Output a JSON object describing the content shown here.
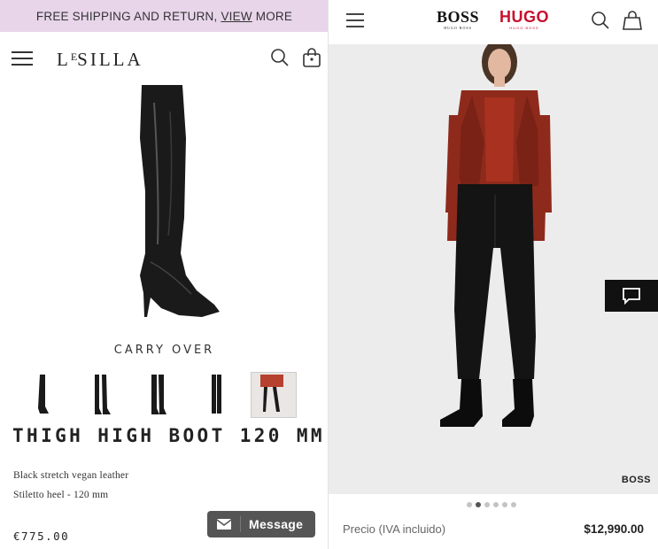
{
  "left": {
    "promo": {
      "before": "FREE SHIPPING AND RETURN,",
      "link": "VIEW",
      "after": "MORE"
    },
    "logo": {
      "main": "L",
      "sup": "E",
      "rest": "SILLA"
    },
    "collection_label": "CARRY OVER",
    "product_title": "THIGH HIGH BOOT 120 MM",
    "description": [
      "Black stretch vegan leather",
      "Stiletto heel - 120 mm"
    ],
    "price": "€775.00",
    "message_button": "Message",
    "icons": {
      "menu": "hamburger-icon",
      "search": "search-icon",
      "bag": "bag-icon",
      "envelope": "envelope-icon"
    }
  },
  "right": {
    "brands": {
      "boss": "BOSS",
      "boss_sub": "HUGO BOSS",
      "hugo": "HUGO",
      "hugo_sub": "HUGO BOSS"
    },
    "photo_brand": "BOSS",
    "price_label": "Precio (IVA incluido)",
    "price": "$12,990.00",
    "carousel": {
      "count": 6,
      "active": 1
    },
    "icons": {
      "menu": "hamburger-icon",
      "search": "search-icon",
      "bag": "bag-icon",
      "chat": "chat-icon"
    }
  },
  "colors": {
    "promo_bg": "#e8d5ea",
    "hugo_red": "#c8102e",
    "jacket": "#8e2a1c",
    "message_btn": "#555555"
  }
}
